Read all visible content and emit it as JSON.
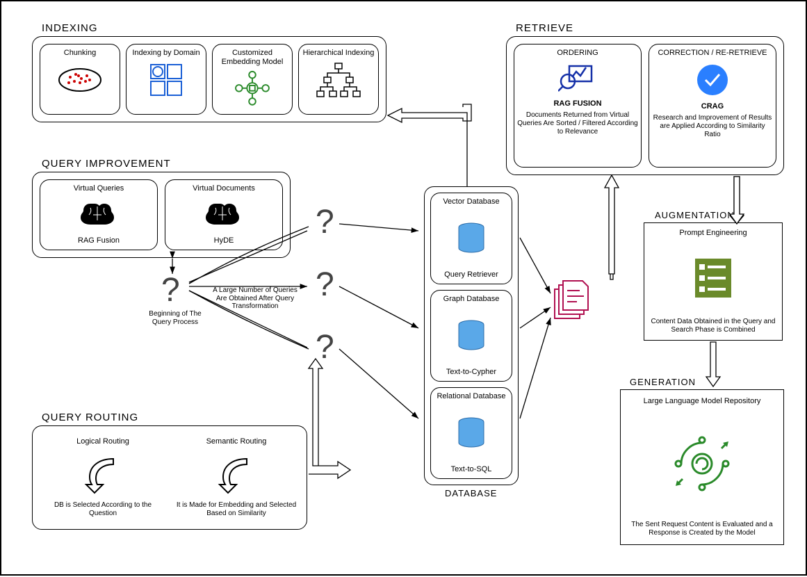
{
  "indexing": {
    "title": "INDEXING",
    "items": [
      "Chunking",
      "Indexing by Domain",
      "Customized Embedding Model",
      "Hierarchical Indexing"
    ]
  },
  "queryImprovement": {
    "title": "QUERY IMPROVEMENT",
    "items": [
      {
        "t": "Virtual Queries",
        "s": "RAG Fusion"
      },
      {
        "t": "Virtual Documents",
        "s": "HyDE"
      }
    ]
  },
  "centerNotes": {
    "begin": "Beginning of The Query Process",
    "many": "A Large Number of Queries Are Obtained After Query Transformation"
  },
  "queryRouting": {
    "title": "QUERY ROUTING",
    "items": [
      {
        "t": "Logical Routing",
        "s": "DB is Selected According to the Question"
      },
      {
        "t": "Semantic Routing",
        "s": "It is Made for Embedding and Selected Based on Similarity"
      }
    ]
  },
  "database": {
    "title": "DATABASE",
    "items": [
      {
        "t": "Vector Database",
        "s": "Query Retriever"
      },
      {
        "t": "Graph Database",
        "s": "Text-to-Cypher"
      },
      {
        "t": "Relational Database",
        "s": "Text-to-SQL"
      }
    ]
  },
  "retrieve": {
    "title": "RETRIEVE",
    "ordering": {
      "h": "ORDERING",
      "t": "RAG FUSION",
      "d": "Documents Returned from Virtual Queries Are Sorted / Filtered According to Relevance"
    },
    "crag": {
      "h": "CORRECTION / RE-RETRIEVE",
      "t": "CRAG",
      "d": "Research and Improvement of Results are Applied According to Similarity Ratio"
    }
  },
  "augmentation": {
    "title": "AUGMENTATION",
    "h": "Prompt Engineering",
    "d": "Content Data Obtained in the Query and Search Phase is Combined"
  },
  "generation": {
    "title": "GENERATION",
    "h": "Large Language Model Repository",
    "d": "The Sent Request Content is Evaluated and a Response is Created by the Model"
  }
}
